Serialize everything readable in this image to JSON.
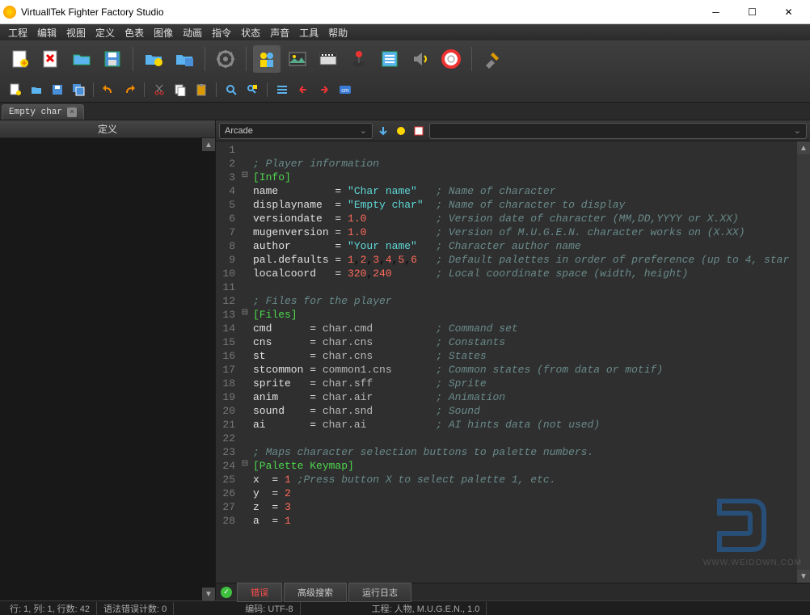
{
  "window": {
    "title": "VirtuallTek Fighter Factory Studio"
  },
  "menu": [
    "工程",
    "编辑",
    "视图",
    "定义",
    "色表",
    "图像",
    "动画",
    "指令",
    "状态",
    "声音",
    "工具",
    "帮助"
  ],
  "tab": {
    "label": "Empty char"
  },
  "side": {
    "header": "定义"
  },
  "editor_toolbar": {
    "combo": "Arcade"
  },
  "code": [
    {
      "n": 1,
      "fold": "",
      "html": ""
    },
    {
      "n": 2,
      "fold": "",
      "html": "<span class='c-comment'>; Player information</span>"
    },
    {
      "n": 3,
      "fold": "⊟",
      "html": "<span class='c-section'>[Info]</span>"
    },
    {
      "n": 4,
      "fold": "",
      "html": "<span class='c-key'>name         </span><span class='c-op'>= </span><span class='c-str'>\"Char name\"</span>   <span class='c-comment'>; Name of character</span>"
    },
    {
      "n": 5,
      "fold": "",
      "html": "<span class='c-key'>displayname  </span><span class='c-op'>= </span><span class='c-str'>\"Empty char\"</span>  <span class='c-comment'>; Name of character to display</span>"
    },
    {
      "n": 6,
      "fold": "",
      "html": "<span class='c-key'>versiondate  </span><span class='c-op'>= </span><span class='c-num'>1.0</span>           <span class='c-comment'>; Version date of character (MM,DD,YYYY or X.XX)</span>"
    },
    {
      "n": 7,
      "fold": "",
      "html": "<span class='c-key'>mugenversion </span><span class='c-op'>= </span><span class='c-num'>1.0</span>           <span class='c-comment'>; Version of M.U.G.E.N. character works on (X.XX)</span>"
    },
    {
      "n": 8,
      "fold": "",
      "html": "<span class='c-key'>author       </span><span class='c-op'>= </span><span class='c-str'>\"Your name\"</span>   <span class='c-comment'>; Character author name</span>"
    },
    {
      "n": 9,
      "fold": "",
      "html": "<span class='c-key'>pal.defaults </span><span class='c-op'>= </span><span class='c-num'>1</span>,<span class='c-num'>2</span>,<span class='c-num'>3</span>,<span class='c-num'>4</span>,<span class='c-num'>5</span>,<span class='c-num'>6</span>   <span class='c-comment'>; Default palettes in order of preference (up to 4, star</span>"
    },
    {
      "n": 10,
      "fold": "",
      "html": "<span class='c-key'>localcoord   </span><span class='c-op'>= </span><span class='c-num'>320</span>,<span class='c-num'>240</span>       <span class='c-comment'>; Local coordinate space (width, height)</span>"
    },
    {
      "n": 11,
      "fold": "",
      "html": ""
    },
    {
      "n": 12,
      "fold": "",
      "html": "<span class='c-comment'>; Files for the player</span>"
    },
    {
      "n": 13,
      "fold": "⊟",
      "html": "<span class='c-section'>[Files]</span>"
    },
    {
      "n": 14,
      "fold": "",
      "html": "<span class='c-key'>cmd      </span><span class='c-op'>= </span><span class='c-plain'>char.cmd</span>          <span class='c-comment'>; Command set</span>"
    },
    {
      "n": 15,
      "fold": "",
      "html": "<span class='c-key'>cns      </span><span class='c-op'>= </span><span class='c-plain'>char.cns</span>          <span class='c-comment'>; Constants</span>"
    },
    {
      "n": 16,
      "fold": "",
      "html": "<span class='c-key'>st       </span><span class='c-op'>= </span><span class='c-plain'>char.cns</span>          <span class='c-comment'>; States</span>"
    },
    {
      "n": 17,
      "fold": "",
      "html": "<span class='c-key'>stcommon </span><span class='c-op'>= </span><span class='c-plain'>common1.cns</span>       <span class='c-comment'>; Common states (from data or motif)</span>"
    },
    {
      "n": 18,
      "fold": "",
      "html": "<span class='c-key'>sprite   </span><span class='c-op'>= </span><span class='c-plain'>char.sff</span>          <span class='c-comment'>; Sprite</span>"
    },
    {
      "n": 19,
      "fold": "",
      "html": "<span class='c-key'>anim     </span><span class='c-op'>= </span><span class='c-plain'>char.air</span>          <span class='c-comment'>; Animation</span>"
    },
    {
      "n": 20,
      "fold": "",
      "html": "<span class='c-key'>sound    </span><span class='c-op'>= </span><span class='c-plain'>char.snd</span>          <span class='c-comment'>; Sound</span>"
    },
    {
      "n": 21,
      "fold": "",
      "html": "<span class='c-key'>ai       </span><span class='c-op'>= </span><span class='c-plain'>char.ai</span>           <span class='c-comment'>; AI hints data (not used)</span>"
    },
    {
      "n": 22,
      "fold": "",
      "html": ""
    },
    {
      "n": 23,
      "fold": "",
      "html": "<span class='c-comment'>; Maps character selection buttons to palette numbers.</span>"
    },
    {
      "n": 24,
      "fold": "⊟",
      "html": "<span class='c-section'>[Palette Keymap]</span>"
    },
    {
      "n": 25,
      "fold": "",
      "html": "<span class='c-key'>x  </span><span class='c-op'>= </span><span class='c-num'>1</span> <span class='c-comment'>;Press button X to select palette 1, etc.</span>"
    },
    {
      "n": 26,
      "fold": "",
      "html": "<span class='c-key'>y  </span><span class='c-op'>= </span><span class='c-num'>2</span>"
    },
    {
      "n": 27,
      "fold": "",
      "html": "<span class='c-key'>z  </span><span class='c-op'>= </span><span class='c-num'>3</span>"
    },
    {
      "n": 28,
      "fold": "",
      "html": "<span class='c-key'>a  </span><span class='c-op'>= </span><span class='c-num'>1</span>"
    }
  ],
  "bottom_tabs": [
    "错误",
    "高级搜索",
    "运行日志"
  ],
  "status": {
    "pos": "行: 1, 列: 1, 行数: 42",
    "syntax": "语法错误计数: 0",
    "encoding": "编码: UTF-8",
    "project": "工程: 人物, M.U.G.E.N., 1.0"
  },
  "watermark": {
    "url": "WWW.WEIDOWN.COM"
  }
}
